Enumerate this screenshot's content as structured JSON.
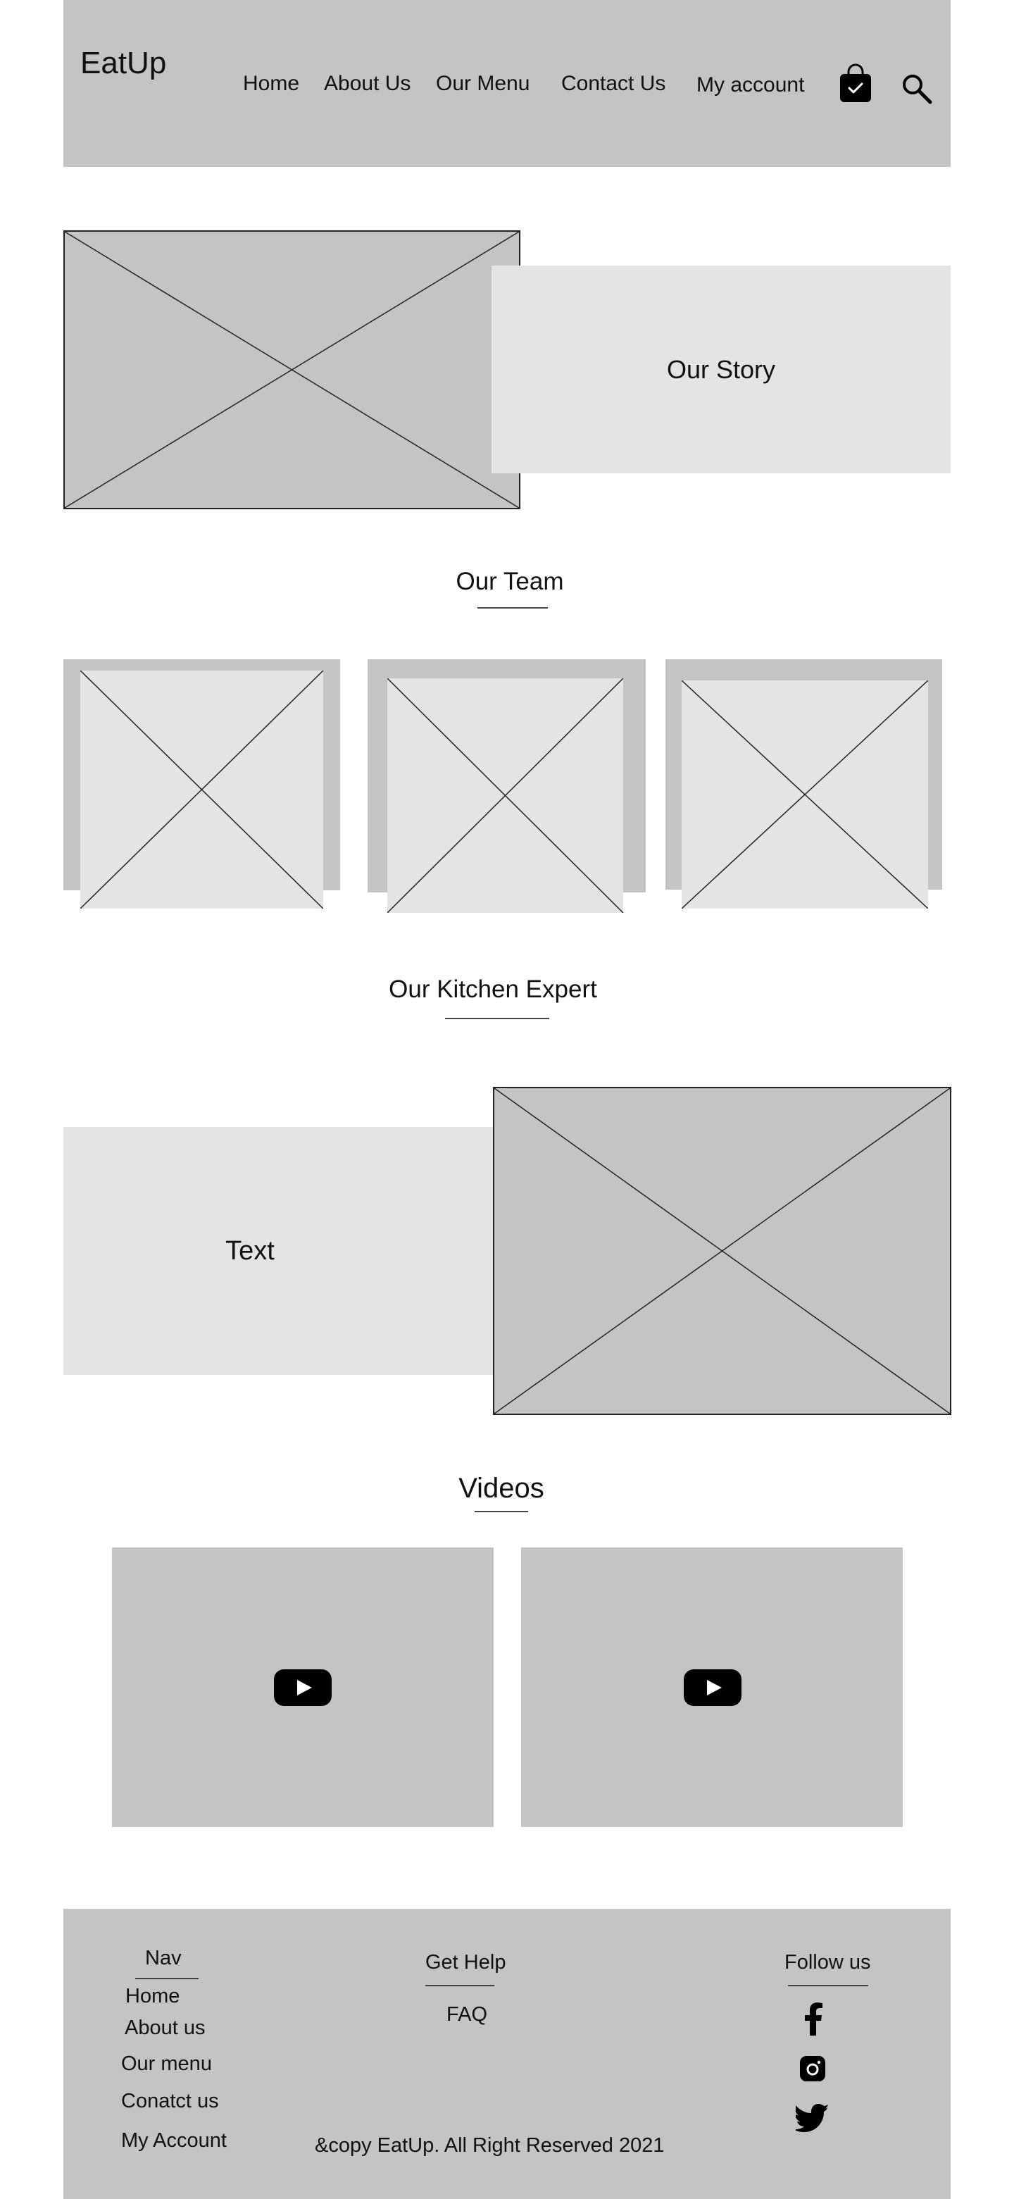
{
  "header": {
    "logo": "EatUp",
    "nav": {
      "home": "Home",
      "about": "About Us",
      "menu": "Our Menu",
      "contact": "Contact Us",
      "account": "My account"
    },
    "icons": [
      "shopping-bag-icon",
      "search-icon"
    ]
  },
  "story": {
    "title": "Our Story"
  },
  "team": {
    "title": "Our Team",
    "member_count": 3
  },
  "kitchen": {
    "title": "Our Kitchen Expert",
    "text": "Text"
  },
  "videos": {
    "title": "Videos",
    "count": 2,
    "icon": "youtube-play-icon"
  },
  "footer": {
    "nav": {
      "heading": "Nav",
      "items": [
        "Home",
        "About us",
        "Our menu",
        "Conatct us",
        "My Account"
      ]
    },
    "help": {
      "heading": "Get Help",
      "items": [
        "FAQ"
      ]
    },
    "follow": {
      "heading": "Follow us",
      "icons": [
        "facebook-icon",
        "instagram-icon",
        "twitter-icon"
      ]
    },
    "copyright": "&copy EatUp. All Right Reserved 2021"
  },
  "colors": {
    "placeholder_dark": "#c4c4c4",
    "placeholder_light": "#e4e4e4",
    "text": "#111111"
  }
}
